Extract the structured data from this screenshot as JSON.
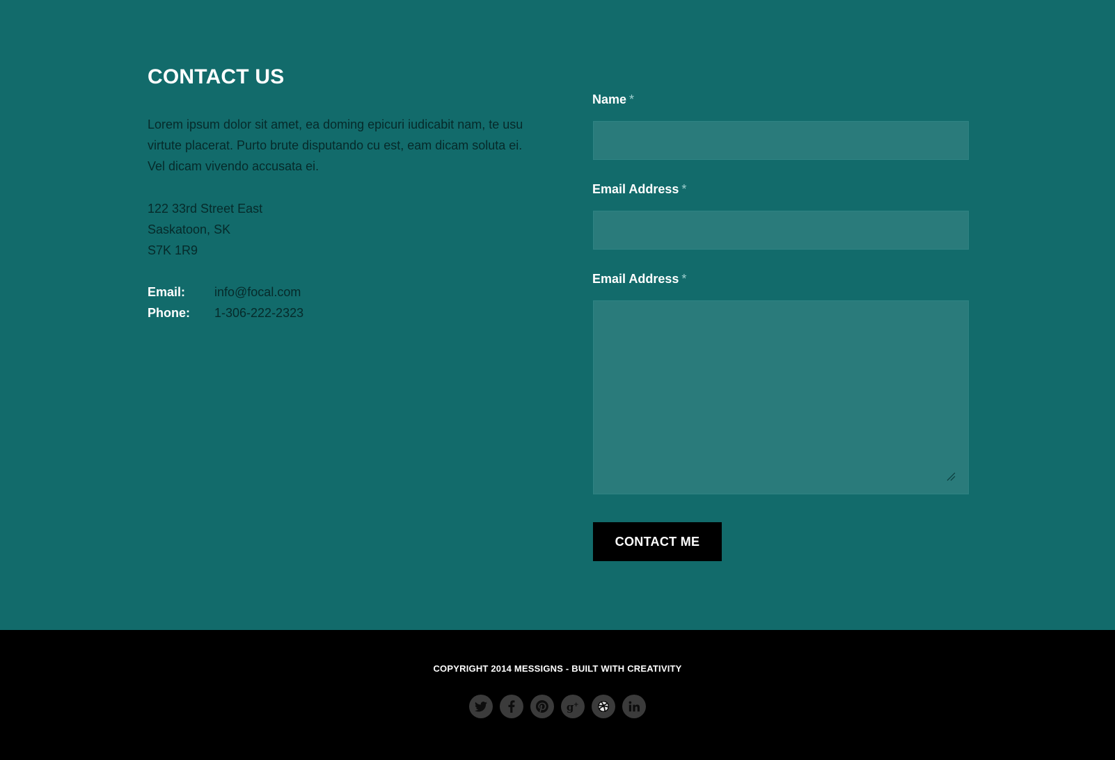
{
  "contact": {
    "title": "CONTACT US",
    "intro": "Lorem ipsum dolor sit amet, ea doming epicuri iudicabit nam, te usu virtute placerat. Purto brute disputando cu est, eam dicam soluta ei. Vel dicam vivendo accusata ei.",
    "address": {
      "line1": "122 33rd Street East",
      "line2": "Saskatoon, SK",
      "line3": "S7K 1R9"
    },
    "email_label": "Email:",
    "email_value": "info@focal.com",
    "phone_label": "Phone:",
    "phone_value": "1-306-222-2323"
  },
  "form": {
    "name_label": "Name",
    "email_label": "Email Address",
    "message_label": "Email Address",
    "required_mark": "*",
    "name_value": "",
    "email_value": "",
    "submit_label": "CONTACT ME"
  },
  "footer": {
    "copyright": "COPYRIGHT 2014 MESSIGNS - BUILT WITH CREATIVITY",
    "social_icons": [
      "twitter-icon",
      "facebook-icon",
      "pinterest-icon",
      "google-plus-icon",
      "dribbble-icon",
      "linkedin-icon"
    ]
  },
  "colors": {
    "section_background": "#126b6b",
    "input_background": "#2a7b7b",
    "button_background": "#000000",
    "footer_background": "#000000"
  }
}
